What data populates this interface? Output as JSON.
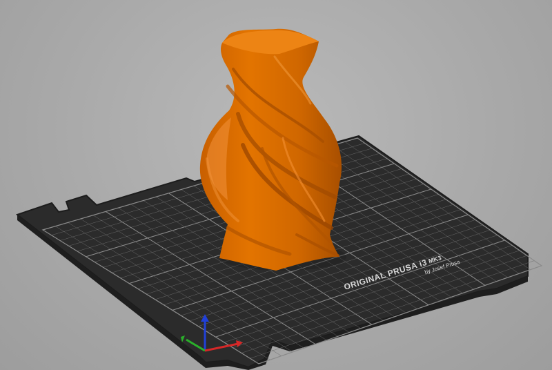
{
  "bed": {
    "brand_line": "ORIGINAL PRUSA i3",
    "model_line": "MK3",
    "credit_line": "by Josef Prusa"
  },
  "colors": {
    "model": "#e37400",
    "bed": "#2b2b2b",
    "bed_edge": "#1c1c1c",
    "grid": "#6a6a6a",
    "background": "#a9a9a9",
    "axis_x": "#d62828",
    "axis_y": "#2ab02a",
    "axis_z": "#2040d8"
  },
  "icons": {
    "axes": "xyz-axes-icon",
    "model": "twisted-vase-model"
  }
}
